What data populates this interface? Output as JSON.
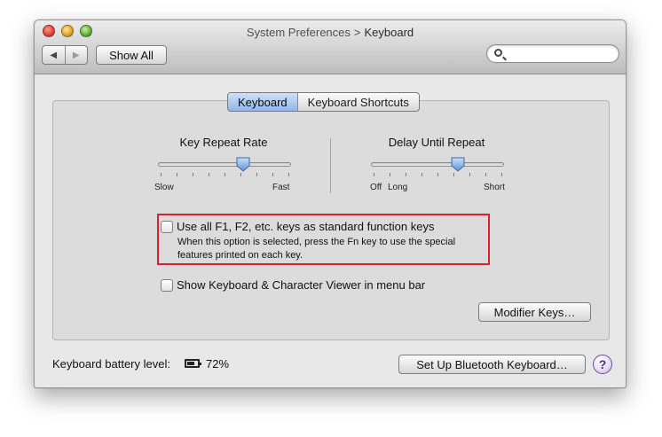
{
  "window": {
    "title_parent": "System Preferences",
    "title_separator": ">",
    "title_current": "Keyboard"
  },
  "toolbar": {
    "back_icon": "back-arrow-icon",
    "forward_icon": "forward-arrow-icon",
    "back_glyph": "◀",
    "forward_glyph": "▶",
    "show_all_label": "Show All",
    "search_placeholder": ""
  },
  "tabs": [
    {
      "label": "Keyboard",
      "active": true
    },
    {
      "label": "Keyboard Shortcuts",
      "active": false
    }
  ],
  "sliders": {
    "key_repeat": {
      "label": "Key Repeat Rate",
      "min_label": "Slow",
      "max_label": "Fast",
      "value_fraction": 0.64
    },
    "delay_until_repeat": {
      "label": "Delay Until Repeat",
      "min_label": "Off",
      "min_label_2": "Long",
      "max_label": "Short",
      "value_fraction": 0.65
    }
  },
  "options": {
    "function_keys": {
      "label": "Use all F1, F2, etc. keys as standard function keys",
      "checked": false,
      "help_line1": "When this option is selected, press the Fn key to use the special",
      "help_line2": "features printed on each key."
    },
    "keyboard_viewer": {
      "label": "Show Keyboard & Character Viewer in menu bar",
      "checked": false
    }
  },
  "buttons": {
    "modifier_keys": "Modifier Keys…",
    "bluetooth_setup": "Set Up Bluetooth Keyboard…",
    "help": "?"
  },
  "battery": {
    "label": "Keyboard battery level:",
    "percent_text": "72%",
    "level": 0.72
  },
  "colors": {
    "highlight_box": "#d9232a",
    "selected_tab": "#8fb6e6",
    "slider_thumb": "#6fa2df"
  }
}
